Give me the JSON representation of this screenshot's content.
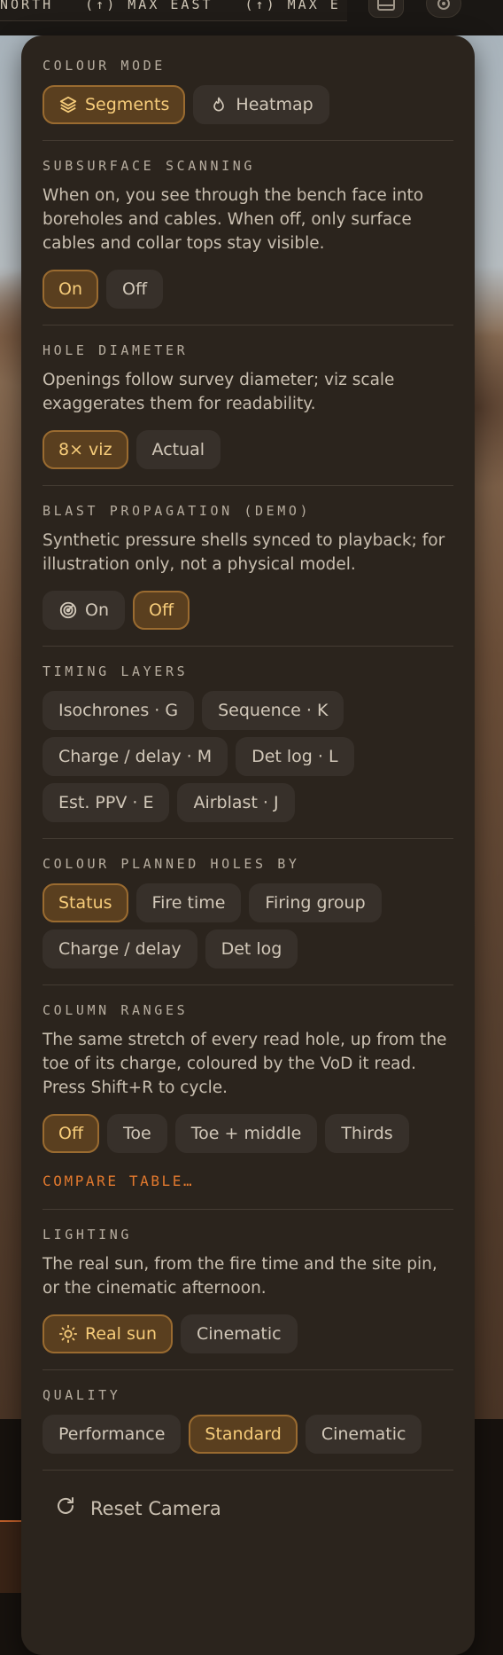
{
  "topbar": {
    "strip_items": [
      "NORTH",
      "(↑) MAX EAST",
      "(↑) MAX E"
    ]
  },
  "colour_mode": {
    "title": "COLOUR MODE",
    "options": [
      {
        "label": "Segments",
        "icon": "layers-icon",
        "active": true
      },
      {
        "label": "Heatmap",
        "icon": "flame-icon",
        "active": false
      }
    ]
  },
  "subsurface": {
    "title": "SUBSURFACE SCANNING",
    "description": "When on, you see through the bench face into boreholes and cables. When off, only surface cables and collar tops stay visible.",
    "options": [
      {
        "label": "On",
        "active": true
      },
      {
        "label": "Off",
        "active": false
      }
    ]
  },
  "hole_diameter": {
    "title": "HOLE DIAMETER",
    "description": "Openings follow survey diameter; viz scale exaggerates them for readability.",
    "options": [
      {
        "label": "8× viz",
        "active": true
      },
      {
        "label": "Actual",
        "active": false
      }
    ]
  },
  "blast_propagation": {
    "title": "BLAST PROPAGATION (DEMO)",
    "description": "Synthetic pressure shells synced to playback; for illustration only, not a physical model.",
    "options": [
      {
        "label": "On",
        "icon": "radar-icon",
        "active": false
      },
      {
        "label": "Off",
        "active": true
      }
    ]
  },
  "timing_layers": {
    "title": "TIMING LAYERS",
    "options": [
      {
        "label": "Isochrones · G"
      },
      {
        "label": "Sequence · K"
      },
      {
        "label": "Charge / delay · M"
      },
      {
        "label": "Det log · L"
      },
      {
        "label": "Est. PPV · E"
      },
      {
        "label": "Airblast · J"
      }
    ]
  },
  "colour_planned": {
    "title": "COLOUR PLANNED HOLES BY",
    "options": [
      {
        "label": "Status",
        "active": true
      },
      {
        "label": "Fire time",
        "active": false
      },
      {
        "label": "Firing group",
        "active": false
      },
      {
        "label": "Charge / delay",
        "active": false
      },
      {
        "label": "Det log",
        "active": false
      }
    ]
  },
  "column_ranges": {
    "title": "COLUMN RANGES",
    "description": "The same stretch of every read hole, up from the toe of its charge, coloured by the VoD it read. Press Shift+R to cycle.",
    "options": [
      {
        "label": "Off",
        "active": true
      },
      {
        "label": "Toe",
        "active": false
      },
      {
        "label": "Toe + middle",
        "active": false
      },
      {
        "label": "Thirds",
        "active": false
      }
    ],
    "compare_link": "COMPARE TABLE…"
  },
  "lighting": {
    "title": "LIGHTING",
    "description": "The real sun, from the fire time and the site pin, or the cinematic afternoon.",
    "options": [
      {
        "label": "Real sun",
        "icon": "sun-icon",
        "active": true
      },
      {
        "label": "Cinematic",
        "active": false
      }
    ]
  },
  "quality": {
    "title": "QUALITY",
    "options": [
      {
        "label": "Performance",
        "active": false
      },
      {
        "label": "Standard",
        "active": true
      },
      {
        "label": "Cinematic",
        "active": false
      }
    ]
  },
  "reset": {
    "label": "Reset Camera",
    "icon": "refresh-icon"
  },
  "colors": {
    "accent": "#f6cc7a",
    "active_bg": "#5a3f1f",
    "link": "#e2792e",
    "panel_bg": "#2b241d"
  }
}
